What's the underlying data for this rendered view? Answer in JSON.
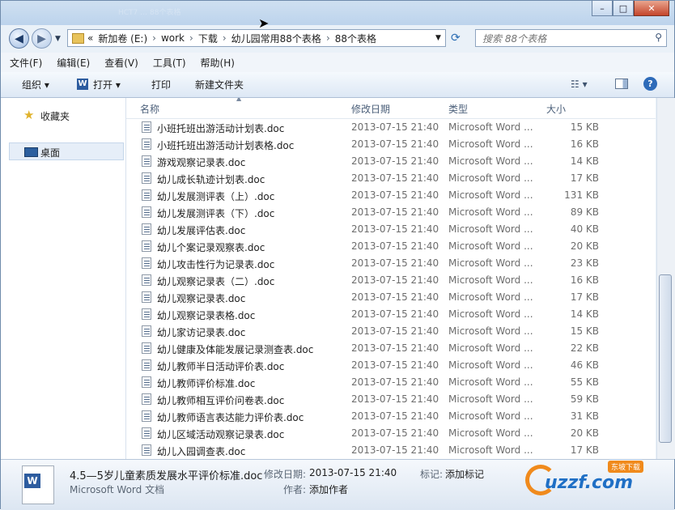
{
  "window": {
    "caption": "HCT7 … 88个表格",
    "controls": {
      "minimize": "–",
      "maximize": "□",
      "close": "✕"
    }
  },
  "nav": {
    "back": "◀",
    "forward": "▶",
    "breadcrumb": [
      "«",
      "新加卷 (E:)",
      "›",
      "work",
      "›",
      "下载",
      "›",
      "幼儿园常用88个表格",
      "›",
      "88个表格"
    ],
    "search_placeholder": "搜索 88个表格"
  },
  "menu": [
    "文件(F)",
    "编辑(E)",
    "查看(V)",
    "工具(T)",
    "帮助(H)"
  ],
  "toolbar": {
    "organize": "组织 ▾",
    "open": "打开 ▾",
    "print": "打印",
    "new_folder": "新建文件夹"
  },
  "sidebar": {
    "favorites": "收藏夹",
    "desktop": "桌面"
  },
  "columns": {
    "name": "名称",
    "date": "修改日期",
    "type": "类型",
    "size": "大小"
  },
  "files": [
    {
      "name": "小班托班出游活动计划表.doc",
      "date": "2013-07-15 21:40",
      "type": "Microsoft Word ...",
      "size": "15 KB"
    },
    {
      "name": "小班托班出游活动计划表格.doc",
      "date": "2013-07-15 21:40",
      "type": "Microsoft Word ...",
      "size": "16 KB"
    },
    {
      "name": "游戏观察记录表.doc",
      "date": "2013-07-15 21:40",
      "type": "Microsoft Word ...",
      "size": "14 KB"
    },
    {
      "name": "幼儿成长轨迹计划表.doc",
      "date": "2013-07-15 21:40",
      "type": "Microsoft Word ...",
      "size": "17 KB"
    },
    {
      "name": "幼儿发展测评表（上）.doc",
      "date": "2013-07-15 21:40",
      "type": "Microsoft Word ...",
      "size": "131 KB"
    },
    {
      "name": "幼儿发展测评表（下）.doc",
      "date": "2013-07-15 21:40",
      "type": "Microsoft Word ...",
      "size": "89 KB"
    },
    {
      "name": "幼儿发展评估表.doc",
      "date": "2013-07-15 21:40",
      "type": "Microsoft Word ...",
      "size": "40 KB"
    },
    {
      "name": "幼儿个案记录观察表.doc",
      "date": "2013-07-15 21:40",
      "type": "Microsoft Word ...",
      "size": "20 KB"
    },
    {
      "name": "幼儿攻击性行为记录表.doc",
      "date": "2013-07-15 21:40",
      "type": "Microsoft Word ...",
      "size": "23 KB"
    },
    {
      "name": "幼儿观察记录表（二）.doc",
      "date": "2013-07-15 21:40",
      "type": "Microsoft Word ...",
      "size": "16 KB"
    },
    {
      "name": "幼儿观察记录表.doc",
      "date": "2013-07-15 21:40",
      "type": "Microsoft Word ...",
      "size": "17 KB"
    },
    {
      "name": "幼儿观察记录表格.doc",
      "date": "2013-07-15 21:40",
      "type": "Microsoft Word ...",
      "size": "14 KB"
    },
    {
      "name": "幼儿家访记录表.doc",
      "date": "2013-07-15 21:40",
      "type": "Microsoft Word ...",
      "size": "15 KB"
    },
    {
      "name": "幼儿健康及体能发展记录测查表.doc",
      "date": "2013-07-15 21:40",
      "type": "Microsoft Word ...",
      "size": "22 KB"
    },
    {
      "name": "幼儿教师半日活动评价表.doc",
      "date": "2013-07-15 21:40",
      "type": "Microsoft Word ...",
      "size": "46 KB"
    },
    {
      "name": "幼儿教师评价标准.doc",
      "date": "2013-07-15 21:40",
      "type": "Microsoft Word ...",
      "size": "55 KB"
    },
    {
      "name": "幼儿教师相互评价问卷表.doc",
      "date": "2013-07-15 21:40",
      "type": "Microsoft Word ...",
      "size": "59 KB"
    },
    {
      "name": "幼儿教师语言表达能力评价表.doc",
      "date": "2013-07-15 21:40",
      "type": "Microsoft Word ...",
      "size": "31 KB"
    },
    {
      "name": "幼儿区域活动观察记录表.doc",
      "date": "2013-07-15 21:40",
      "type": "Microsoft Word ...",
      "size": "20 KB"
    },
    {
      "name": "幼儿入园调查表.doc",
      "date": "2013-07-15 21:40",
      "type": "Microsoft Word ...",
      "size": "17 KB"
    }
  ],
  "details": {
    "filename": "4.5—5岁儿童素质发展水平评价标准.doc",
    "filetype": "Microsoft Word 文档",
    "modified_label": "修改日期:",
    "modified_value": "2013-07-15 21:40",
    "tags_label": "标记:",
    "tags_value": "添加标记",
    "author_label": "作者:",
    "author_value": "添加作者"
  },
  "watermark": {
    "site": "uzzf.com",
    "sub": "东坡下载"
  },
  "colors": {
    "accent": "#1f6fc5",
    "watermark_orange": "#f08a1c"
  }
}
